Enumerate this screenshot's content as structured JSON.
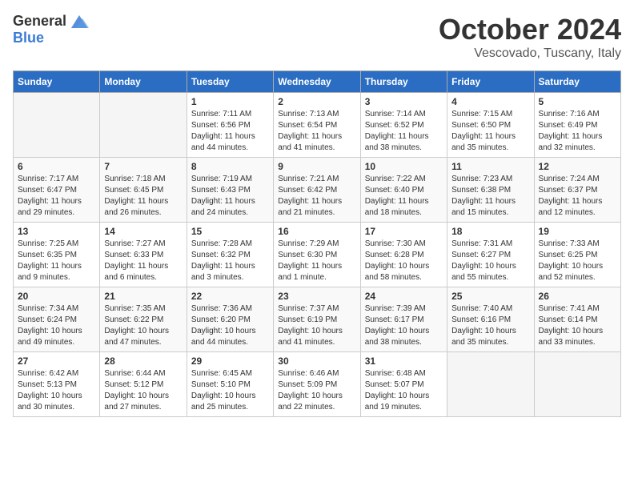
{
  "header": {
    "logo_general": "General",
    "logo_blue": "Blue",
    "month_title": "October 2024",
    "location": "Vescovado, Tuscany, Italy"
  },
  "days_of_week": [
    "Sunday",
    "Monday",
    "Tuesday",
    "Wednesday",
    "Thursday",
    "Friday",
    "Saturday"
  ],
  "weeks": [
    [
      {
        "day": "",
        "empty": true
      },
      {
        "day": "",
        "empty": true
      },
      {
        "day": "1",
        "sunrise": "Sunrise: 7:11 AM",
        "sunset": "Sunset: 6:56 PM",
        "daylight": "Daylight: 11 hours and 44 minutes."
      },
      {
        "day": "2",
        "sunrise": "Sunrise: 7:13 AM",
        "sunset": "Sunset: 6:54 PM",
        "daylight": "Daylight: 11 hours and 41 minutes."
      },
      {
        "day": "3",
        "sunrise": "Sunrise: 7:14 AM",
        "sunset": "Sunset: 6:52 PM",
        "daylight": "Daylight: 11 hours and 38 minutes."
      },
      {
        "day": "4",
        "sunrise": "Sunrise: 7:15 AM",
        "sunset": "Sunset: 6:50 PM",
        "daylight": "Daylight: 11 hours and 35 minutes."
      },
      {
        "day": "5",
        "sunrise": "Sunrise: 7:16 AM",
        "sunset": "Sunset: 6:49 PM",
        "daylight": "Daylight: 11 hours and 32 minutes."
      }
    ],
    [
      {
        "day": "6",
        "sunrise": "Sunrise: 7:17 AM",
        "sunset": "Sunset: 6:47 PM",
        "daylight": "Daylight: 11 hours and 29 minutes."
      },
      {
        "day": "7",
        "sunrise": "Sunrise: 7:18 AM",
        "sunset": "Sunset: 6:45 PM",
        "daylight": "Daylight: 11 hours and 26 minutes."
      },
      {
        "day": "8",
        "sunrise": "Sunrise: 7:19 AM",
        "sunset": "Sunset: 6:43 PM",
        "daylight": "Daylight: 11 hours and 24 minutes."
      },
      {
        "day": "9",
        "sunrise": "Sunrise: 7:21 AM",
        "sunset": "Sunset: 6:42 PM",
        "daylight": "Daylight: 11 hours and 21 minutes."
      },
      {
        "day": "10",
        "sunrise": "Sunrise: 7:22 AM",
        "sunset": "Sunset: 6:40 PM",
        "daylight": "Daylight: 11 hours and 18 minutes."
      },
      {
        "day": "11",
        "sunrise": "Sunrise: 7:23 AM",
        "sunset": "Sunset: 6:38 PM",
        "daylight": "Daylight: 11 hours and 15 minutes."
      },
      {
        "day": "12",
        "sunrise": "Sunrise: 7:24 AM",
        "sunset": "Sunset: 6:37 PM",
        "daylight": "Daylight: 11 hours and 12 minutes."
      }
    ],
    [
      {
        "day": "13",
        "sunrise": "Sunrise: 7:25 AM",
        "sunset": "Sunset: 6:35 PM",
        "daylight": "Daylight: 11 hours and 9 minutes."
      },
      {
        "day": "14",
        "sunrise": "Sunrise: 7:27 AM",
        "sunset": "Sunset: 6:33 PM",
        "daylight": "Daylight: 11 hours and 6 minutes."
      },
      {
        "day": "15",
        "sunrise": "Sunrise: 7:28 AM",
        "sunset": "Sunset: 6:32 PM",
        "daylight": "Daylight: 11 hours and 3 minutes."
      },
      {
        "day": "16",
        "sunrise": "Sunrise: 7:29 AM",
        "sunset": "Sunset: 6:30 PM",
        "daylight": "Daylight: 11 hours and 1 minute."
      },
      {
        "day": "17",
        "sunrise": "Sunrise: 7:30 AM",
        "sunset": "Sunset: 6:28 PM",
        "daylight": "Daylight: 10 hours and 58 minutes."
      },
      {
        "day": "18",
        "sunrise": "Sunrise: 7:31 AM",
        "sunset": "Sunset: 6:27 PM",
        "daylight": "Daylight: 10 hours and 55 minutes."
      },
      {
        "day": "19",
        "sunrise": "Sunrise: 7:33 AM",
        "sunset": "Sunset: 6:25 PM",
        "daylight": "Daylight: 10 hours and 52 minutes."
      }
    ],
    [
      {
        "day": "20",
        "sunrise": "Sunrise: 7:34 AM",
        "sunset": "Sunset: 6:24 PM",
        "daylight": "Daylight: 10 hours and 49 minutes."
      },
      {
        "day": "21",
        "sunrise": "Sunrise: 7:35 AM",
        "sunset": "Sunset: 6:22 PM",
        "daylight": "Daylight: 10 hours and 47 minutes."
      },
      {
        "day": "22",
        "sunrise": "Sunrise: 7:36 AM",
        "sunset": "Sunset: 6:20 PM",
        "daylight": "Daylight: 10 hours and 44 minutes."
      },
      {
        "day": "23",
        "sunrise": "Sunrise: 7:37 AM",
        "sunset": "Sunset: 6:19 PM",
        "daylight": "Daylight: 10 hours and 41 minutes."
      },
      {
        "day": "24",
        "sunrise": "Sunrise: 7:39 AM",
        "sunset": "Sunset: 6:17 PM",
        "daylight": "Daylight: 10 hours and 38 minutes."
      },
      {
        "day": "25",
        "sunrise": "Sunrise: 7:40 AM",
        "sunset": "Sunset: 6:16 PM",
        "daylight": "Daylight: 10 hours and 35 minutes."
      },
      {
        "day": "26",
        "sunrise": "Sunrise: 7:41 AM",
        "sunset": "Sunset: 6:14 PM",
        "daylight": "Daylight: 10 hours and 33 minutes."
      }
    ],
    [
      {
        "day": "27",
        "sunrise": "Sunrise: 6:42 AM",
        "sunset": "Sunset: 5:13 PM",
        "daylight": "Daylight: 10 hours and 30 minutes."
      },
      {
        "day": "28",
        "sunrise": "Sunrise: 6:44 AM",
        "sunset": "Sunset: 5:12 PM",
        "daylight": "Daylight: 10 hours and 27 minutes."
      },
      {
        "day": "29",
        "sunrise": "Sunrise: 6:45 AM",
        "sunset": "Sunset: 5:10 PM",
        "daylight": "Daylight: 10 hours and 25 minutes."
      },
      {
        "day": "30",
        "sunrise": "Sunrise: 6:46 AM",
        "sunset": "Sunset: 5:09 PM",
        "daylight": "Daylight: 10 hours and 22 minutes."
      },
      {
        "day": "31",
        "sunrise": "Sunrise: 6:48 AM",
        "sunset": "Sunset: 5:07 PM",
        "daylight": "Daylight: 10 hours and 19 minutes."
      },
      {
        "day": "",
        "empty": true
      },
      {
        "day": "",
        "empty": true
      }
    ]
  ]
}
